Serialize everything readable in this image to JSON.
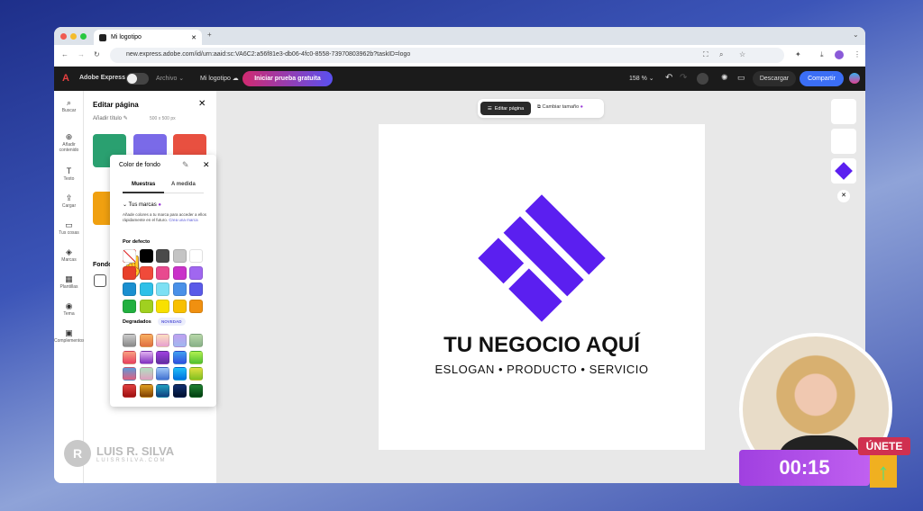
{
  "browser": {
    "tab_title": "Mi logotipo",
    "url": "new.express.adobe.com/id/urn:aaid:sc:VA6C2:a56f81e3-db06-4fc0-8558-73970803962b?taskID=logo"
  },
  "app": {
    "name": "Adobe Express",
    "menu": "Archivo",
    "doc_name": "Mi logotipo",
    "trial_button": "Iniciar prueba gratuita",
    "zoom": "158 %",
    "download": "Descargar",
    "share": "Compartir"
  },
  "rail": [
    {
      "icon": "search-icon",
      "glyph": "⌕",
      "label": "Buscar"
    },
    {
      "icon": "add-icon",
      "glyph": "⊕",
      "label": "Añadir contenido"
    },
    {
      "icon": "text-icon",
      "glyph": "T",
      "label": "Texto"
    },
    {
      "icon": "upload-icon",
      "glyph": "⇪",
      "label": "Cargar"
    },
    {
      "icon": "folder-icon",
      "glyph": "▭",
      "label": "Tus cosas"
    },
    {
      "icon": "brand-icon",
      "glyph": "◈",
      "label": "Marcas"
    },
    {
      "icon": "templates-icon",
      "glyph": "▦",
      "label": "Plantillas"
    },
    {
      "icon": "theme-icon",
      "glyph": "◉",
      "label": "Tema"
    },
    {
      "icon": "addons-icon",
      "glyph": "▣",
      "label": "Complementos"
    }
  ],
  "panel": {
    "title": "Editar página",
    "add_title": "Añadir título",
    "size": "500 x 500 px",
    "fondo": "Fondo"
  },
  "popover": {
    "title": "Color de fondo",
    "tabs": [
      "Muestras",
      "A medida"
    ],
    "brands": "Tus marcas",
    "brands_text": "Añade colores a tu marca para acceder a ellos rápidamente en el futuro.",
    "brands_link": "Crea una marca",
    "default_label": "Por defecto",
    "gradients_label": "Degradados",
    "new_badge": "NOVEDAD",
    "default_colors": [
      "none",
      "#000000",
      "#4a4a4a",
      "#c4c4c4",
      "#ffffff",
      "#e8402a",
      "#f04a3a",
      "#e84a8f",
      "#c932c9",
      "#a067f0",
      "#1a8fd0",
      "#2ec0e8",
      "#7de0f4",
      "#4a90e8",
      "#5a5ae8",
      "#22b040",
      "#a0d020",
      "#f8e000",
      "#f8c000",
      "#f09010"
    ],
    "gradients": [
      [
        "#ccc",
        "#888"
      ],
      [
        "#f8b060",
        "#e07040"
      ],
      [
        "#fde0c0",
        "#e8a0d0"
      ],
      [
        "#c0a0f0",
        "#a0b8f0"
      ],
      [
        "#b8d8a8",
        "#88b088"
      ],
      [
        "#f8a080",
        "#e84060"
      ],
      [
        "#e0b0f0",
        "#8030c0"
      ],
      [
        "#a040e0",
        "#6030a0"
      ],
      [
        "#40a0f0",
        "#3050e0"
      ],
      [
        "#b0f050",
        "#50c030"
      ],
      [
        "#6098d8",
        "#e06080"
      ],
      [
        "#b0e0c0",
        "#e0a0c0"
      ],
      [
        "#a0c8f8",
        "#4070d0"
      ],
      [
        "#20c0f8",
        "#0070e0"
      ],
      [
        "#e0e040",
        "#80c020"
      ],
      [
        "#e04040",
        "#a01010"
      ],
      [
        "#e0a020",
        "#804000"
      ],
      [
        "#20a0c0",
        "#104080"
      ],
      [
        "#103070",
        "#001030"
      ],
      [
        "#208030",
        "#004010"
      ]
    ]
  },
  "toolbar": {
    "edit_page": "Editar página",
    "resize": "Cambiar tamaño"
  },
  "logo": {
    "title": "TU NEGOCIO AQUÍ",
    "slogan": "ESLOGAN • PRODUCTO • SERVICIO",
    "color": "#5b1ff0"
  },
  "watermark": {
    "name": "LUIS R. SILVA",
    "site": "LUISRSILVA.COM"
  },
  "overlay": {
    "timer": "00:15",
    "join": "ÚNETE"
  }
}
